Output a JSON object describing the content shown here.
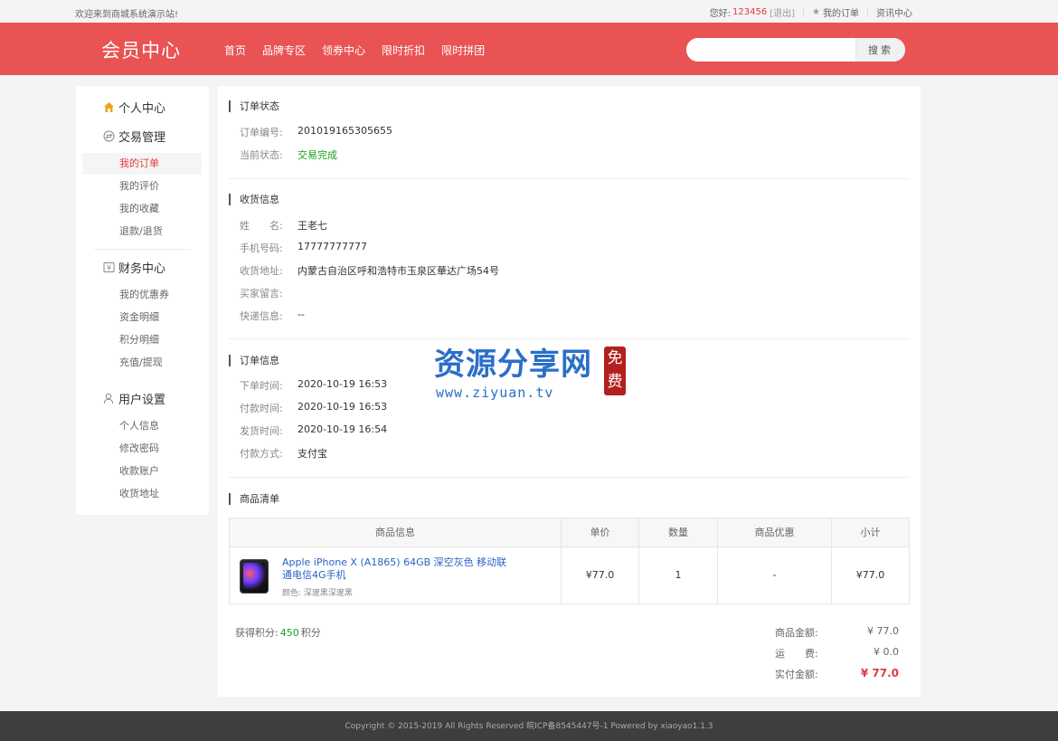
{
  "topbar": {
    "welcome": "欢迎来到商城系统演示站!",
    "hello": "您好:",
    "username": "123456",
    "logout": "[退出]",
    "my_orders": "我的订单",
    "news": "资讯中心"
  },
  "header": {
    "brand": "会员中心",
    "nav": [
      "首页",
      "品牌专区",
      "领券中心",
      "限时折扣",
      "限时拼团"
    ],
    "search_placeholder": "",
    "search_button": "搜索"
  },
  "sidebar": {
    "personal": "个人中心",
    "trade": {
      "title": "交易管理",
      "items": [
        "我的订单",
        "我的评价",
        "我的收藏",
        "退款/退货"
      ]
    },
    "finance": {
      "title": "财务中心",
      "items": [
        "我的优惠券",
        "资金明细",
        "积分明细",
        "充值/提现"
      ]
    },
    "settings": {
      "title": "用户设置",
      "items": [
        "个人信息",
        "修改密码",
        "收款账户",
        "收货地址"
      ]
    }
  },
  "order_status": {
    "title": "订单状态",
    "order_no_label": "订单编号:",
    "order_no": "201019165305655",
    "status_label": "当前状态:",
    "status": "交易完成"
  },
  "shipping": {
    "title": "收货信息",
    "name_label": "姓　　名:",
    "name": "王老七",
    "phone_label": "手机号码:",
    "phone": "17777777777",
    "address_label": "收货地址:",
    "address": "内蒙古自治区呼和浩特市玉泉区華达广场54号",
    "note_label": "买家留言:",
    "note": "",
    "express_label": "快递信息:",
    "express": "--"
  },
  "order_info": {
    "title": "订单信息",
    "created_label": "下单时间:",
    "created": "2020-10-19 16:53",
    "paid_label": "付款时间:",
    "paid": "2020-10-19 16:53",
    "shipped_label": "发货时间:",
    "shipped": "2020-10-19 16:54",
    "method_label": "付款方式:",
    "method": "支付宝"
  },
  "goods": {
    "title": "商品清单",
    "headers": [
      "商品信息",
      "单价",
      "数量",
      "商品优惠",
      "小计"
    ],
    "rows": [
      {
        "name": "Apple iPhone X (A1865) 64GB 深空灰色 移动联通电信4G手机",
        "attr": "颜色: 深邃黑深邃黑",
        "price": "¥77.0",
        "qty": "1",
        "discount": "-",
        "subtotal": "¥77.0"
      }
    ]
  },
  "totals": {
    "points_label": "获得积分:",
    "points": "450",
    "points_unit": "积分",
    "goods_amount_label": "商品金额:",
    "goods_amount": "¥ 77.0",
    "shipping_label": "运　　费:",
    "shipping": "¥ 0.0",
    "paid_label": "实付金额:",
    "paid": "¥ 77.0"
  },
  "watermark": {
    "title": "资源分享网",
    "url": "www.ziyuan.tv",
    "seal": "免费"
  },
  "footer": {
    "text": "Copyright © 2015-2019 All Rights Reserved 皖ICP备8545447号-1    Powered by xiaoyao1.1.3"
  },
  "colors": {
    "header_bg": "#e95353",
    "accent_red": "#e4393c",
    "status_green": "#1aa01a",
    "link_blue": "#2b62c4"
  }
}
